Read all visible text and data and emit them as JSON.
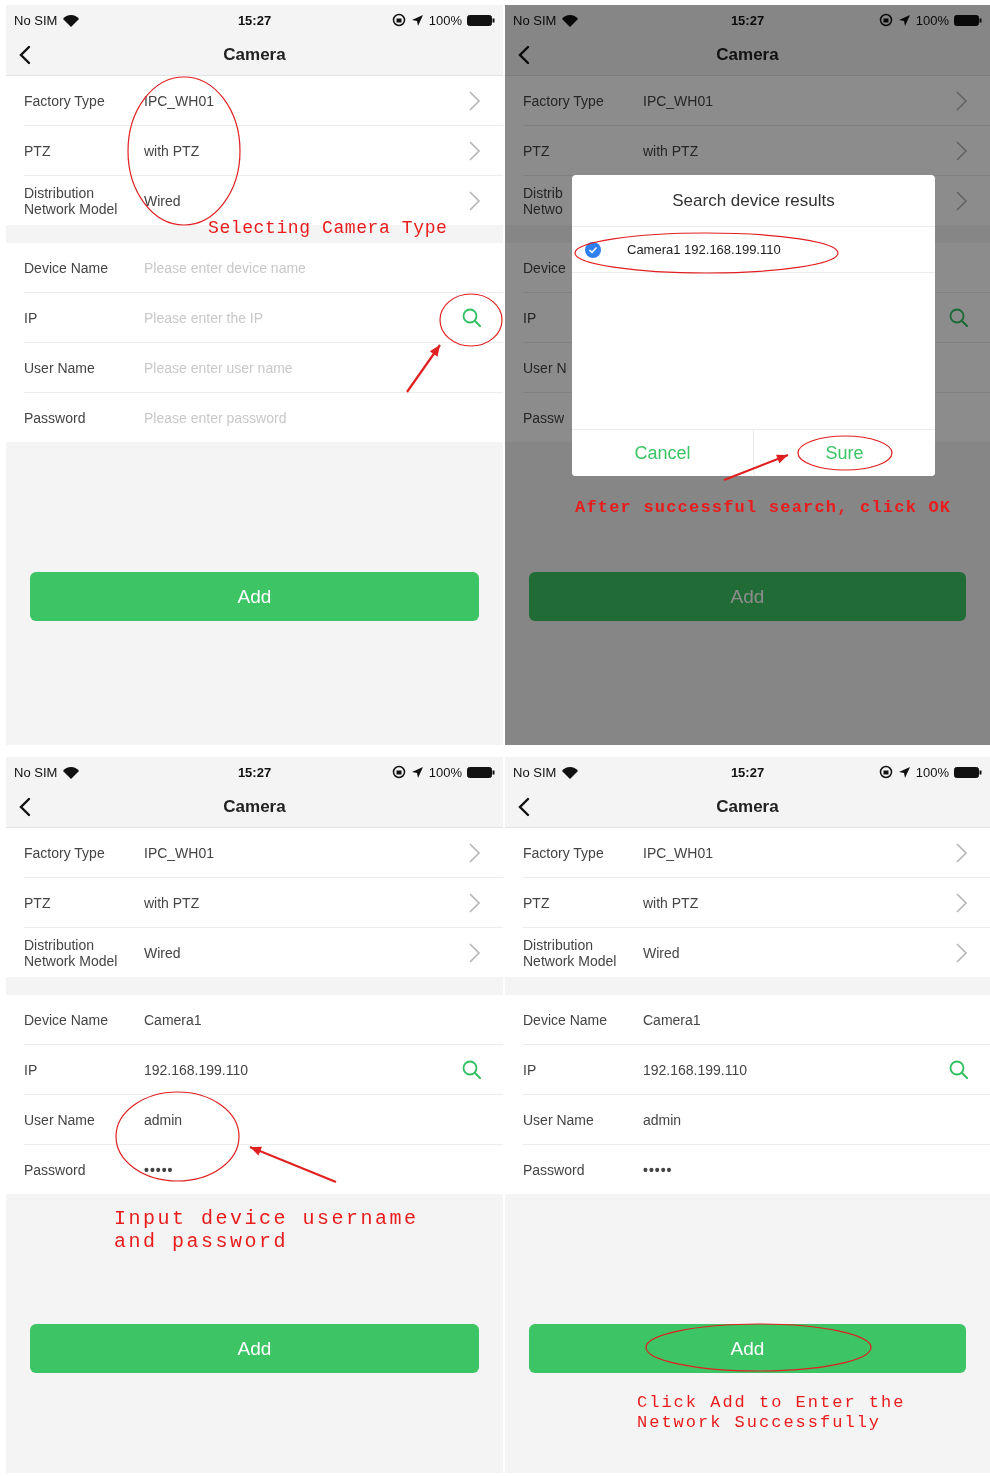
{
  "panels": [
    {
      "status_bar": {
        "carrier": "No SIM",
        "time": "15:27",
        "battery": "100%"
      },
      "title": "Camera",
      "groups": [
        [
          {
            "kind": "select",
            "label": "Factory Type",
            "value": "IPC_WH01"
          },
          {
            "kind": "select",
            "label": "PTZ",
            "value": "with PTZ"
          },
          {
            "kind": "select",
            "label": "Distribution Network Model",
            "value": "Wired"
          }
        ],
        [
          {
            "kind": "text",
            "label": "Device Name",
            "placeholder": "Please enter device name"
          },
          {
            "kind": "ip",
            "label": "IP",
            "placeholder": "Please enter the IP"
          },
          {
            "kind": "text",
            "label": "User Name",
            "placeholder": "Please enter user name"
          },
          {
            "kind": "text",
            "label": "Password",
            "placeholder": "Please enter password"
          }
        ]
      ],
      "add_button": "Add",
      "note": "Selecting Camera Type"
    },
    {
      "status_bar": {
        "carrier": "No SIM",
        "time": "15:27",
        "battery": "100%"
      },
      "title": "Camera",
      "dimmed": true,
      "groups": [
        [
          {
            "kind": "select",
            "label": "Factory Type",
            "value": "IPC_WH01"
          },
          {
            "kind": "select",
            "label": "PTZ",
            "value": "with PTZ"
          },
          {
            "kind": "select",
            "label": "Distrib\nNetwo"
          }
        ],
        [
          {
            "kind": "text",
            "label": "Device"
          },
          {
            "kind": "ip",
            "label": "IP"
          },
          {
            "kind": "text",
            "label": "User N"
          },
          {
            "kind": "text",
            "label": "Passw"
          }
        ]
      ],
      "dialog": {
        "title": "Search device results",
        "results": [
          {
            "label": "Camera1 192.168.199.110",
            "checked": true
          }
        ],
        "buttons": [
          "Cancel",
          "Sure"
        ]
      },
      "add_button": "Add",
      "note": "After successful search, click OK"
    },
    {
      "status_bar": {
        "carrier": "No SIM",
        "time": "15:27",
        "battery": "100%"
      },
      "title": "Camera",
      "groups": [
        [
          {
            "kind": "select",
            "label": "Factory Type",
            "value": "IPC_WH01"
          },
          {
            "kind": "select",
            "label": "PTZ",
            "value": "with PTZ"
          },
          {
            "kind": "select",
            "label": "Distribution Network Model",
            "value": "Wired"
          }
        ],
        [
          {
            "kind": "text",
            "label": "Device Name",
            "value": "Camera1"
          },
          {
            "kind": "ip",
            "label": "IP",
            "value": "192.168.199.110"
          },
          {
            "kind": "text",
            "label": "User Name",
            "value": "admin"
          },
          {
            "kind": "password",
            "label": "Password",
            "value": "•••••"
          }
        ]
      ],
      "add_button": "Add",
      "note": "Input device username and password"
    },
    {
      "status_bar": {
        "carrier": "No SIM",
        "time": "15:27",
        "battery": "100%"
      },
      "title": "Camera",
      "groups": [
        [
          {
            "kind": "select",
            "label": "Factory Type",
            "value": "IPC_WH01"
          },
          {
            "kind": "select",
            "label": "PTZ",
            "value": "with PTZ"
          },
          {
            "kind": "select",
            "label": "Distribution Network Model",
            "value": "Wired"
          }
        ],
        [
          {
            "kind": "text",
            "label": "Device Name",
            "value": "Camera1"
          },
          {
            "kind": "ip",
            "label": "IP",
            "value": "192.168.199.110"
          },
          {
            "kind": "text",
            "label": "User Name",
            "value": "admin"
          },
          {
            "kind": "password",
            "label": "Password",
            "value": "•••••"
          }
        ]
      ],
      "add_button": "Add",
      "note": "Click Add to Enter the Network Successfully"
    }
  ]
}
